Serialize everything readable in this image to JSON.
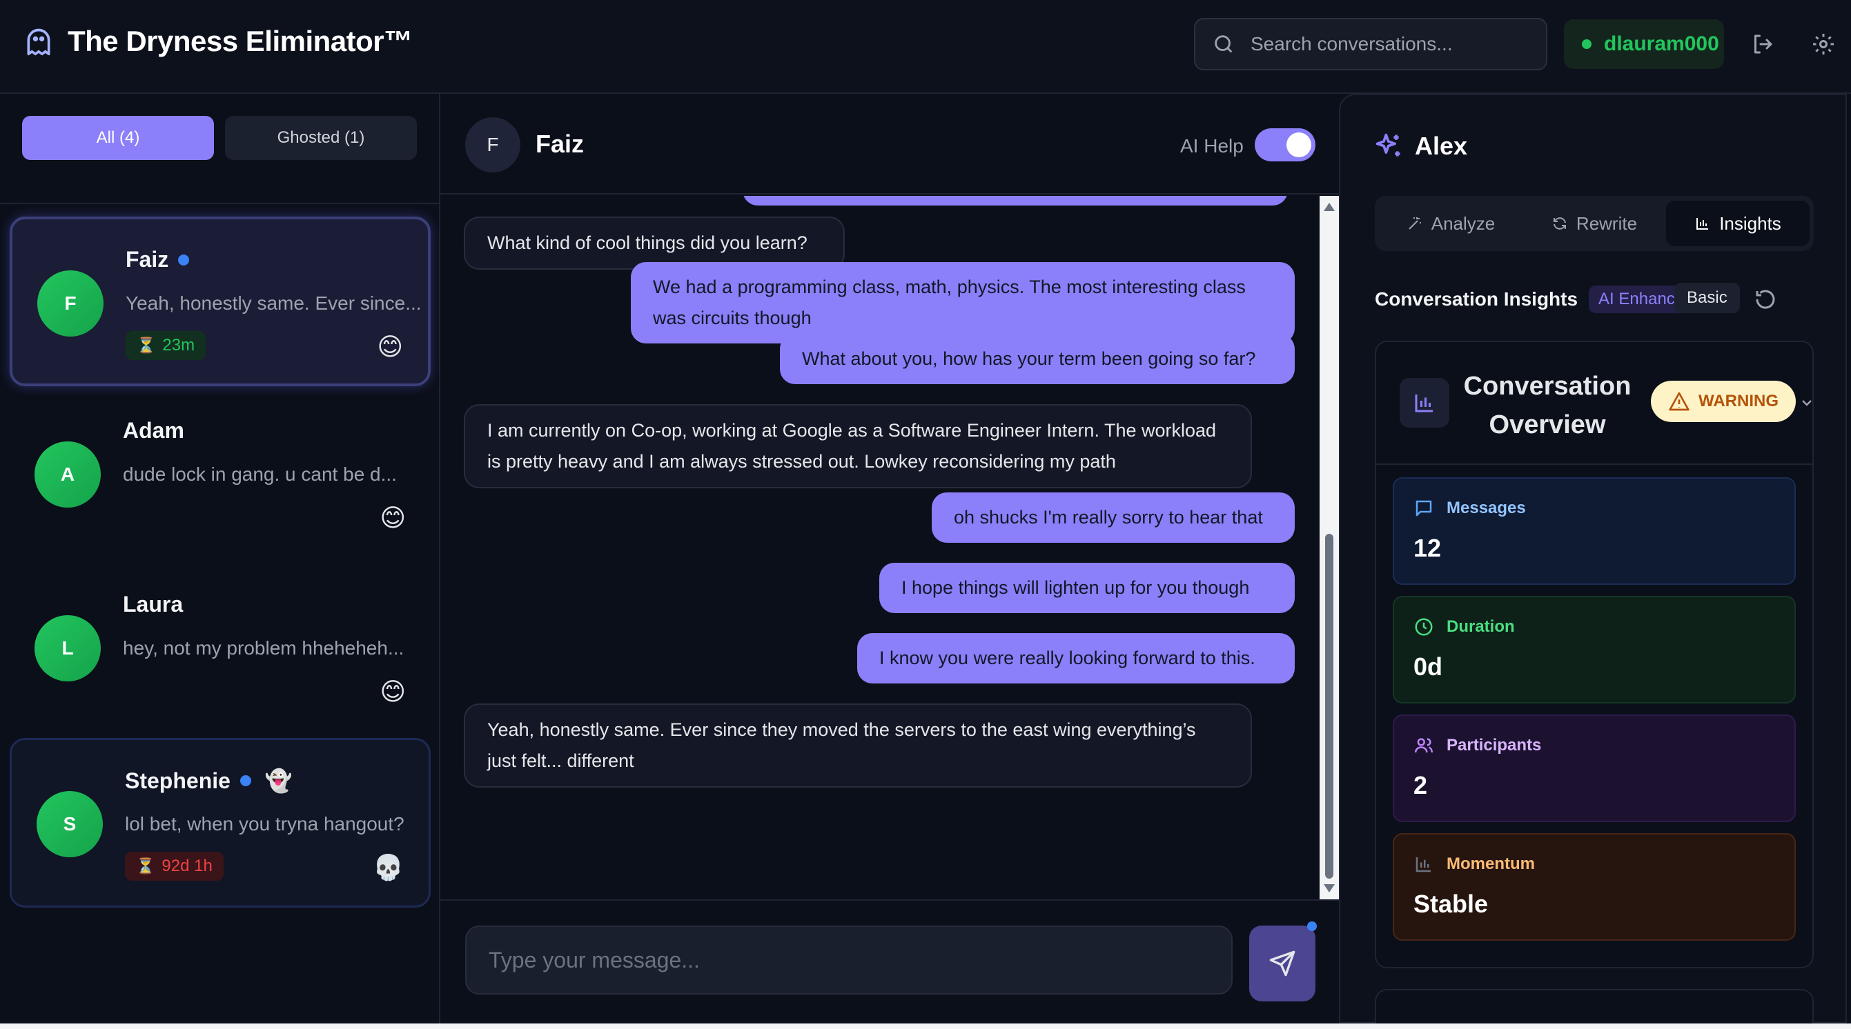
{
  "header": {
    "app_title": "The Dryness Eliminator™",
    "search_placeholder": "Search conversations...",
    "username": "dlauram000",
    "icons": [
      "ghost-icon",
      "search-icon",
      "logout-icon",
      "settings-icon"
    ]
  },
  "sidebar": {
    "filters": [
      {
        "label": "All (4)",
        "active": true
      },
      {
        "label": "Ghosted (1)",
        "active": false
      }
    ],
    "conversations": [
      {
        "initial": "F",
        "name": "Faiz",
        "online": true,
        "ghosted": false,
        "preview": "Yeah, honestly same. Ever since...",
        "timer": "23m",
        "timer_status": "green",
        "mood": "😊"
      },
      {
        "initial": "A",
        "name": "Adam",
        "online": false,
        "ghosted": false,
        "preview": "dude lock in gang. u cant be d...",
        "timer": "",
        "mood": "😊"
      },
      {
        "initial": "L",
        "name": "Laura",
        "online": false,
        "ghosted": false,
        "preview": "hey, not my problem hheheheh...",
        "timer": "",
        "mood": "😊"
      },
      {
        "initial": "S",
        "name": "Stephenie",
        "online": true,
        "ghosted": true,
        "ghost_emoji": "👻",
        "preview": "lol bet, when you tryna hangout?",
        "timer": "92d 1h",
        "timer_status": "red",
        "mood": "💀"
      }
    ]
  },
  "chat": {
    "contact_initial": "F",
    "contact_name": "Faiz",
    "ai_help_label": "AI Help",
    "ai_help_on": true,
    "messages": [
      {
        "dir": "in",
        "text": "What kind of cool things did you learn?"
      },
      {
        "dir": "out",
        "text": "We had a programming class, math, physics. The most interesting class was circuits though"
      },
      {
        "dir": "out",
        "text": "What about you, how has your term been going so far?"
      },
      {
        "dir": "in",
        "text": "I am currently on Co-op, working at Google as a Software Engineer Intern. The workload is pretty heavy and I am always stressed out. Lowkey reconsidering my path"
      },
      {
        "dir": "out",
        "text": "oh shucks I'm really sorry to hear that"
      },
      {
        "dir": "out",
        "text": "I hope things will lighten up for you though"
      },
      {
        "dir": "out",
        "text": "I know you were really looking forward to this."
      },
      {
        "dir": "in",
        "text": "Yeah, honestly same. Ever since they moved the servers to the east wing everything’s just felt... different"
      }
    ],
    "composer_placeholder": "Type your message..."
  },
  "panel": {
    "title": "Alex",
    "tabs": [
      {
        "label": "Analyze",
        "active": false
      },
      {
        "label": "Rewrite",
        "active": false
      },
      {
        "label": "Insights",
        "active": true
      }
    ],
    "insights_title": "Conversation Insights",
    "ai_badge": "AI Enhanced",
    "basic_label": "Basic",
    "overview_title": "Conversation Overview",
    "warning_label": "WARNING",
    "stats": [
      {
        "label": "Messages",
        "value": "12"
      },
      {
        "label": "Duration",
        "value": "0d"
      },
      {
        "label": "Participants",
        "value": "2"
      },
      {
        "label": "Momentum",
        "value": "Stable"
      }
    ]
  },
  "colors": {
    "accent": "#8b80f9",
    "background": "#0b0f19",
    "online_green": "#22c55e",
    "warning": "#fef3c7",
    "danger": "#ef4444"
  }
}
